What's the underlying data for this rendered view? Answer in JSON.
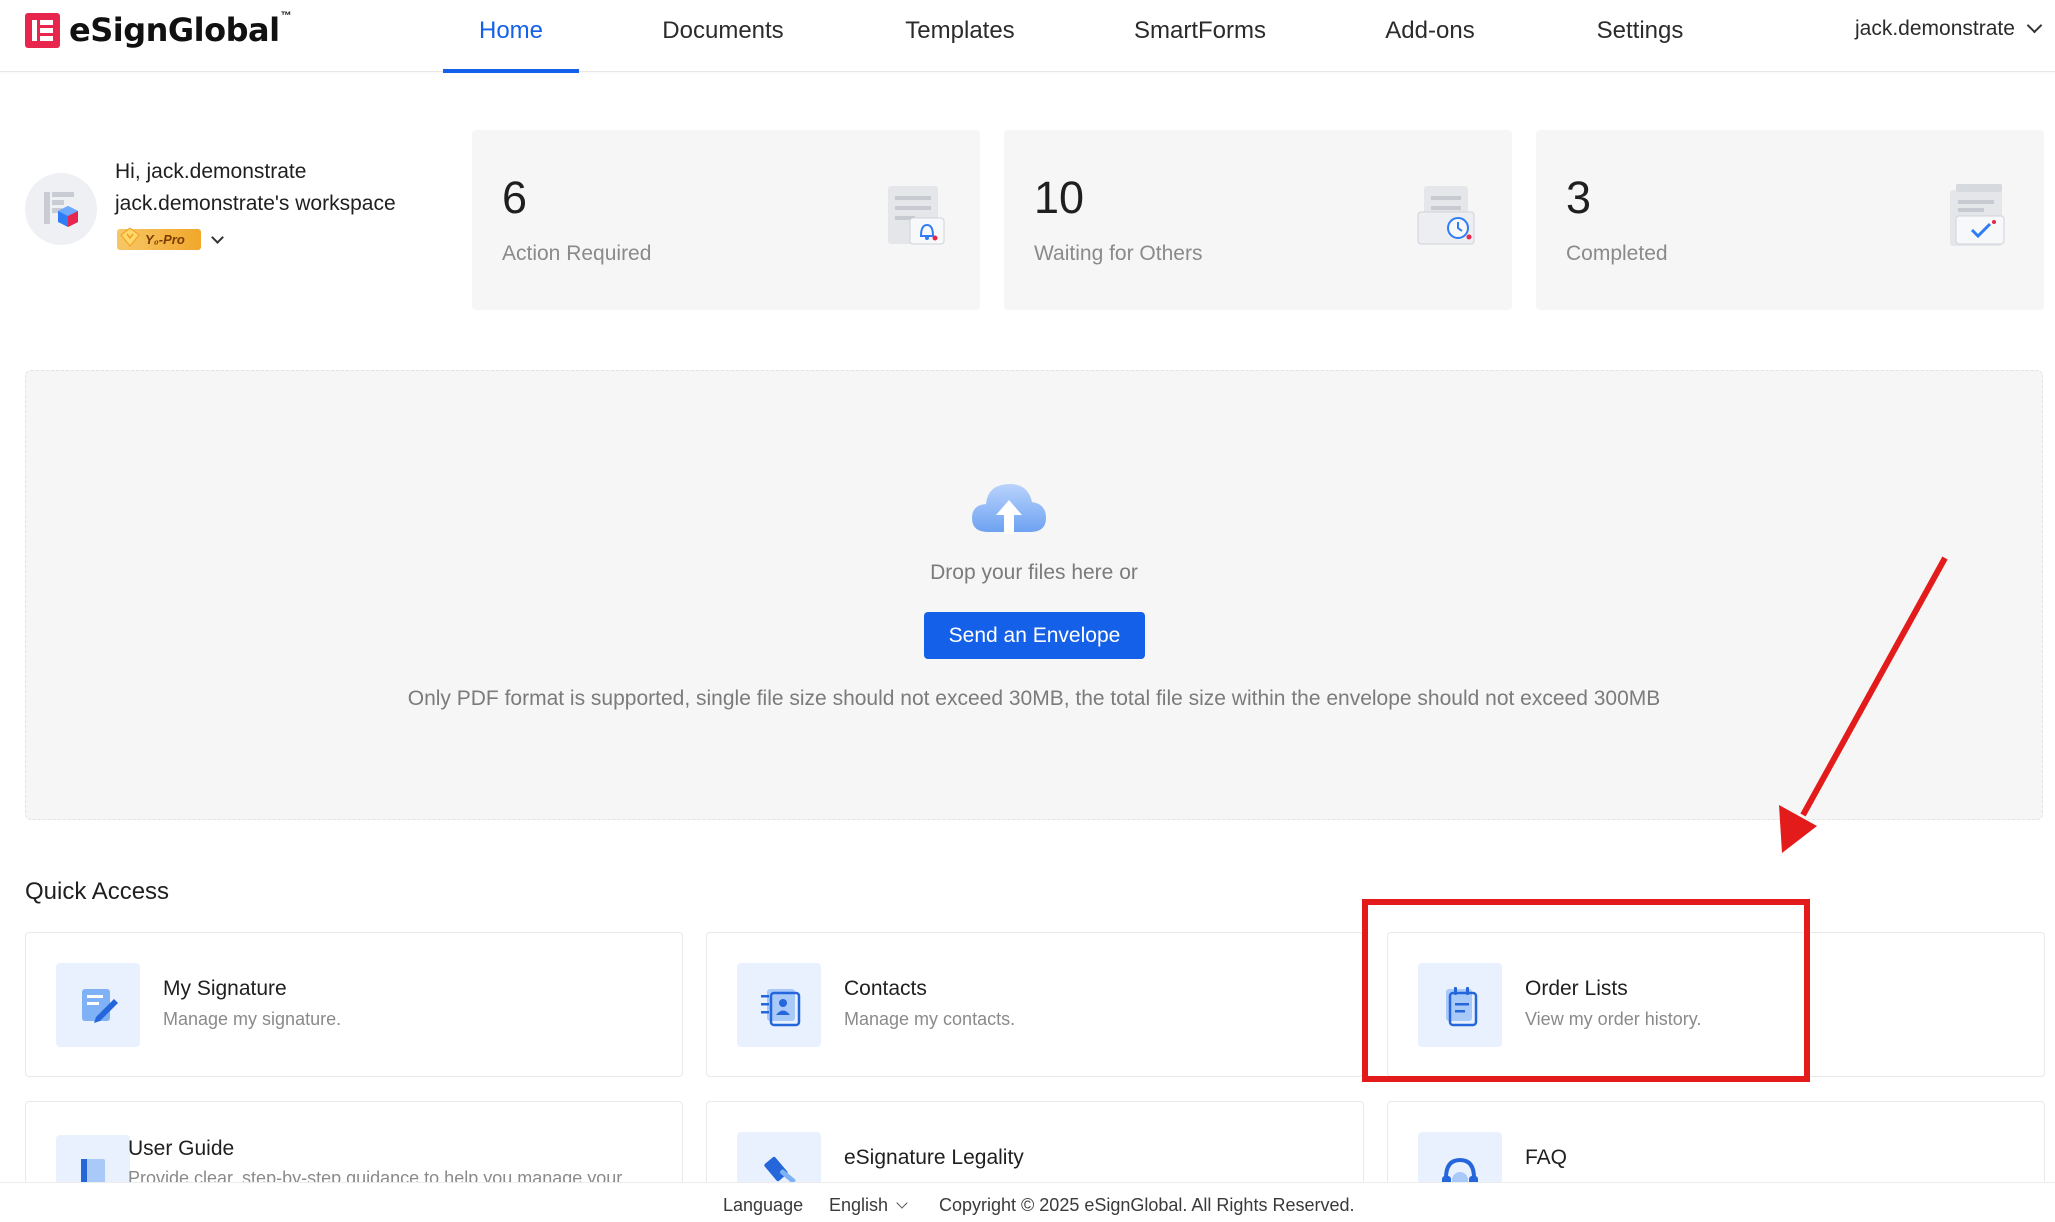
{
  "header": {
    "logo_text": "eSignGlobal",
    "logo_tm": "™",
    "nav": [
      "Home",
      "Documents",
      "Templates",
      "SmartForms",
      "Add-ons",
      "Settings"
    ],
    "active_nav": "Home",
    "user": "jack.demonstrate"
  },
  "profile": {
    "greeting": "Hi, jack.demonstrate",
    "workspace": "jack.demonstrate's workspace",
    "plan_badge": "Y₀-Pro"
  },
  "stats": [
    {
      "count": "6",
      "label": "Action Required"
    },
    {
      "count": "10",
      "label": "Waiting for Others"
    },
    {
      "count": "3",
      "label": "Completed"
    }
  ],
  "upload": {
    "drop_text": "Drop your files here or",
    "button_label": "Send an Envelope",
    "hint": "Only PDF format is supported, single file size should not exceed 30MB, the total file size within the envelope should not exceed 300MB"
  },
  "quick_access": {
    "title": "Quick Access",
    "items": [
      {
        "name": "My Signature",
        "desc": "Manage my signature.",
        "icon": "signature-icon"
      },
      {
        "name": "Contacts",
        "desc": "Manage my contacts.",
        "icon": "contacts-icon"
      },
      {
        "name": "Order Lists",
        "desc": "View my order history.",
        "icon": "order-list-icon"
      },
      {
        "name": "User Guide",
        "desc": "Provide clear, step-by-step guidance to help you manage your",
        "icon": "book-icon"
      },
      {
        "name": "eSignature Legality",
        "desc": "",
        "icon": "gavel-icon"
      },
      {
        "name": "FAQ",
        "desc": "",
        "icon": "headset-icon"
      }
    ]
  },
  "footer": {
    "language_label": "Language",
    "language_value": "English",
    "copyright": "Copyright © 2025 eSignGlobal. All Rights Reserved."
  },
  "colors": {
    "accent": "#1560e8",
    "brand": "#e8264d",
    "annotation": "#e31b1b"
  }
}
